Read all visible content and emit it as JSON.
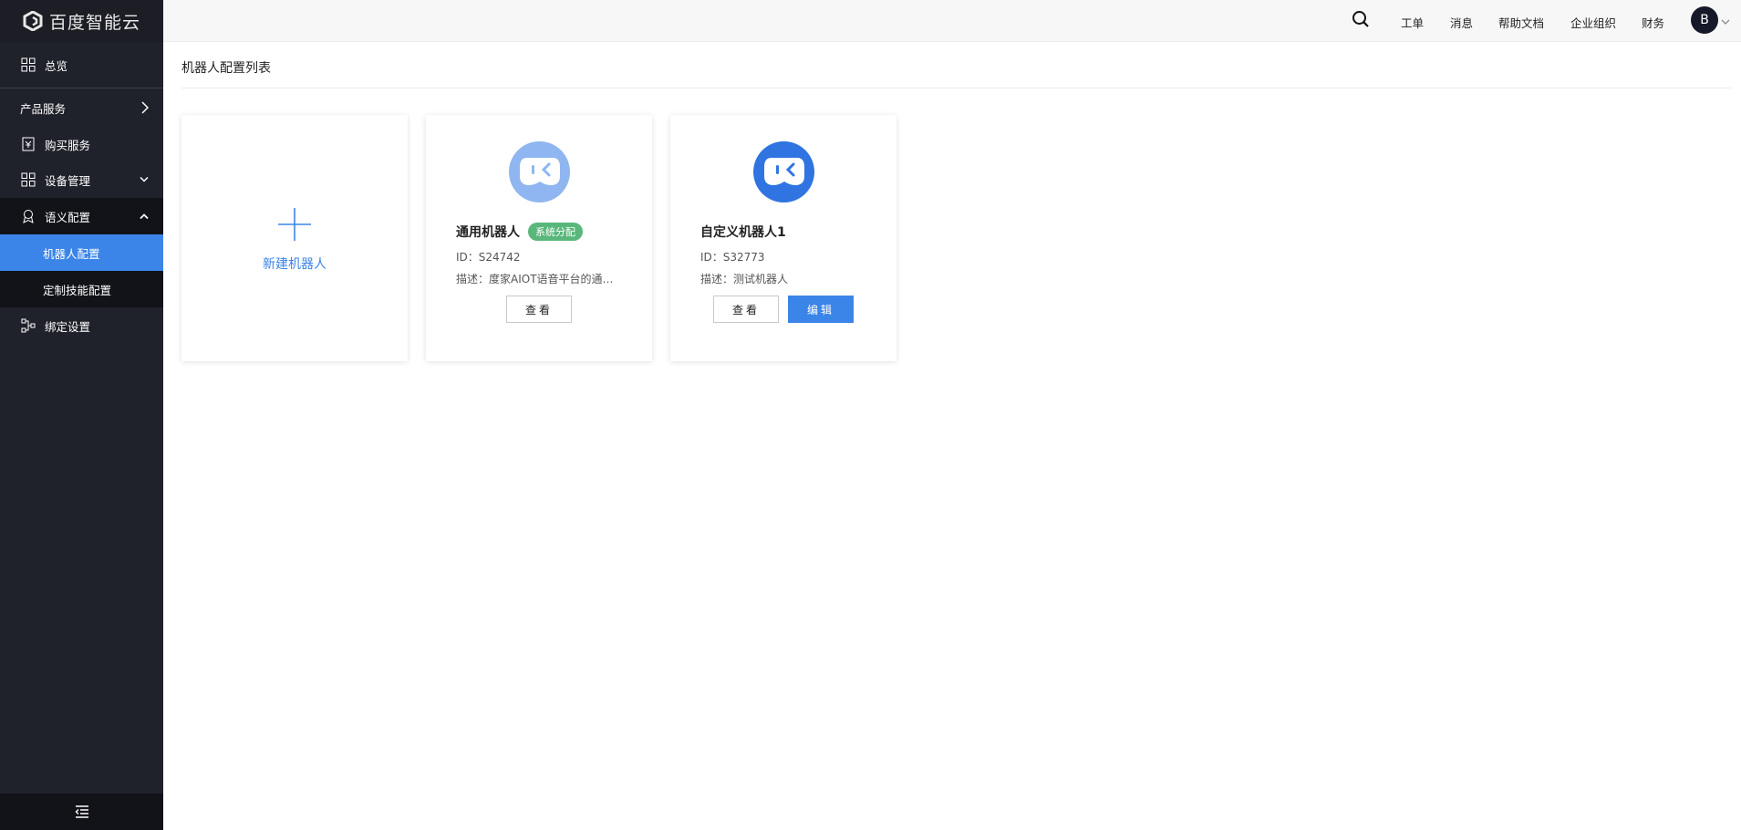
{
  "app": {
    "logo_text": "百度智能云"
  },
  "sidebar": {
    "overview": "总览",
    "product_services": "产品服务",
    "buy_service": "购买服务",
    "device_mgmt": "设备管理",
    "semantic_config": "语义配置",
    "sub_items": [
      "机器人配置",
      "定制技能配置"
    ],
    "binding": "绑定设置"
  },
  "header": {
    "links": [
      "工单",
      "消息",
      "帮助文档",
      "企业组织",
      "财务"
    ],
    "avatar_letter": "B"
  },
  "main": {
    "title": "机器人配置列表",
    "new_robot_label": "新建机器人",
    "robots": [
      {
        "name": "通用机器人",
        "tag": "系统分配",
        "id": "ID：S24742",
        "desc": "描述：度家AIOT语音平台的通…",
        "view_label": "查看"
      },
      {
        "name": "自定义机器人1",
        "id": "ID：S32773",
        "desc": "描述：测试机器人",
        "view_label": "查看",
        "edit_label": "编辑"
      }
    ]
  },
  "colors": {
    "sidebar_bg": "#20222b",
    "active": "#3b85e8",
    "tag_green": "#5ab77c",
    "robot_light": "#8fb6f0",
    "robot_dark": "#2f74e0"
  }
}
